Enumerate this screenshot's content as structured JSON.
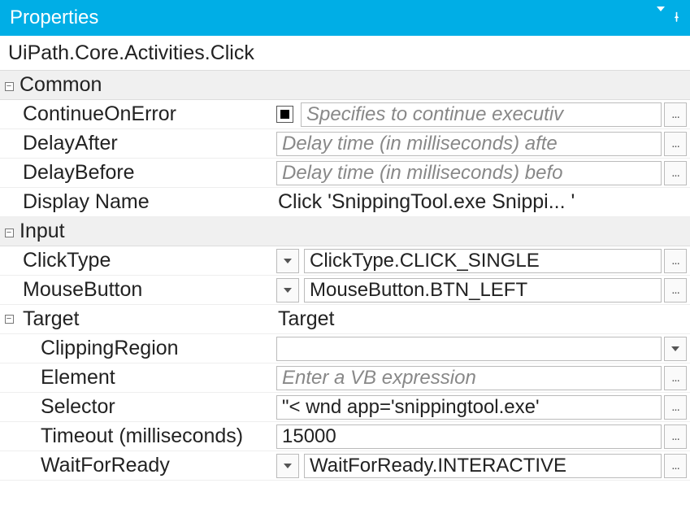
{
  "title": "Properties",
  "className": "UiPath.Core.Activities.Click",
  "categories": {
    "common": {
      "label": "Common",
      "continueOnError": {
        "label": "ContinueOnError",
        "placeholder": "Specifies to continue executiv"
      },
      "delayAfter": {
        "label": "DelayAfter",
        "placeholder": "Delay time (in milliseconds) afte"
      },
      "delayBefore": {
        "label": "DelayBefore",
        "placeholder": "Delay time (in milliseconds) befo"
      },
      "displayName": {
        "label": "Display Name",
        "value": "Click 'SnippingTool.exe Snippi... '"
      }
    },
    "input": {
      "label": "Input",
      "clickType": {
        "label": "ClickType",
        "value": "ClickType.CLICK_SINGLE"
      },
      "mouseButton": {
        "label": "MouseButton",
        "value": "MouseButton.BTN_LEFT"
      },
      "target": {
        "label": "Target",
        "value": "Target",
        "clippingRegion": {
          "label": "ClippingRegion",
          "value": ""
        },
        "element": {
          "label": "Element",
          "placeholder": "Enter a VB expression"
        },
        "selector": {
          "label": "Selector",
          "value": "\"< wnd app='snippingtool.exe' "
        },
        "timeout": {
          "label": "Timeout (milliseconds)",
          "value": "15000"
        },
        "waitForReady": {
          "label": "WaitForReady",
          "value": "WaitForReady.INTERACTIVE"
        }
      }
    }
  }
}
